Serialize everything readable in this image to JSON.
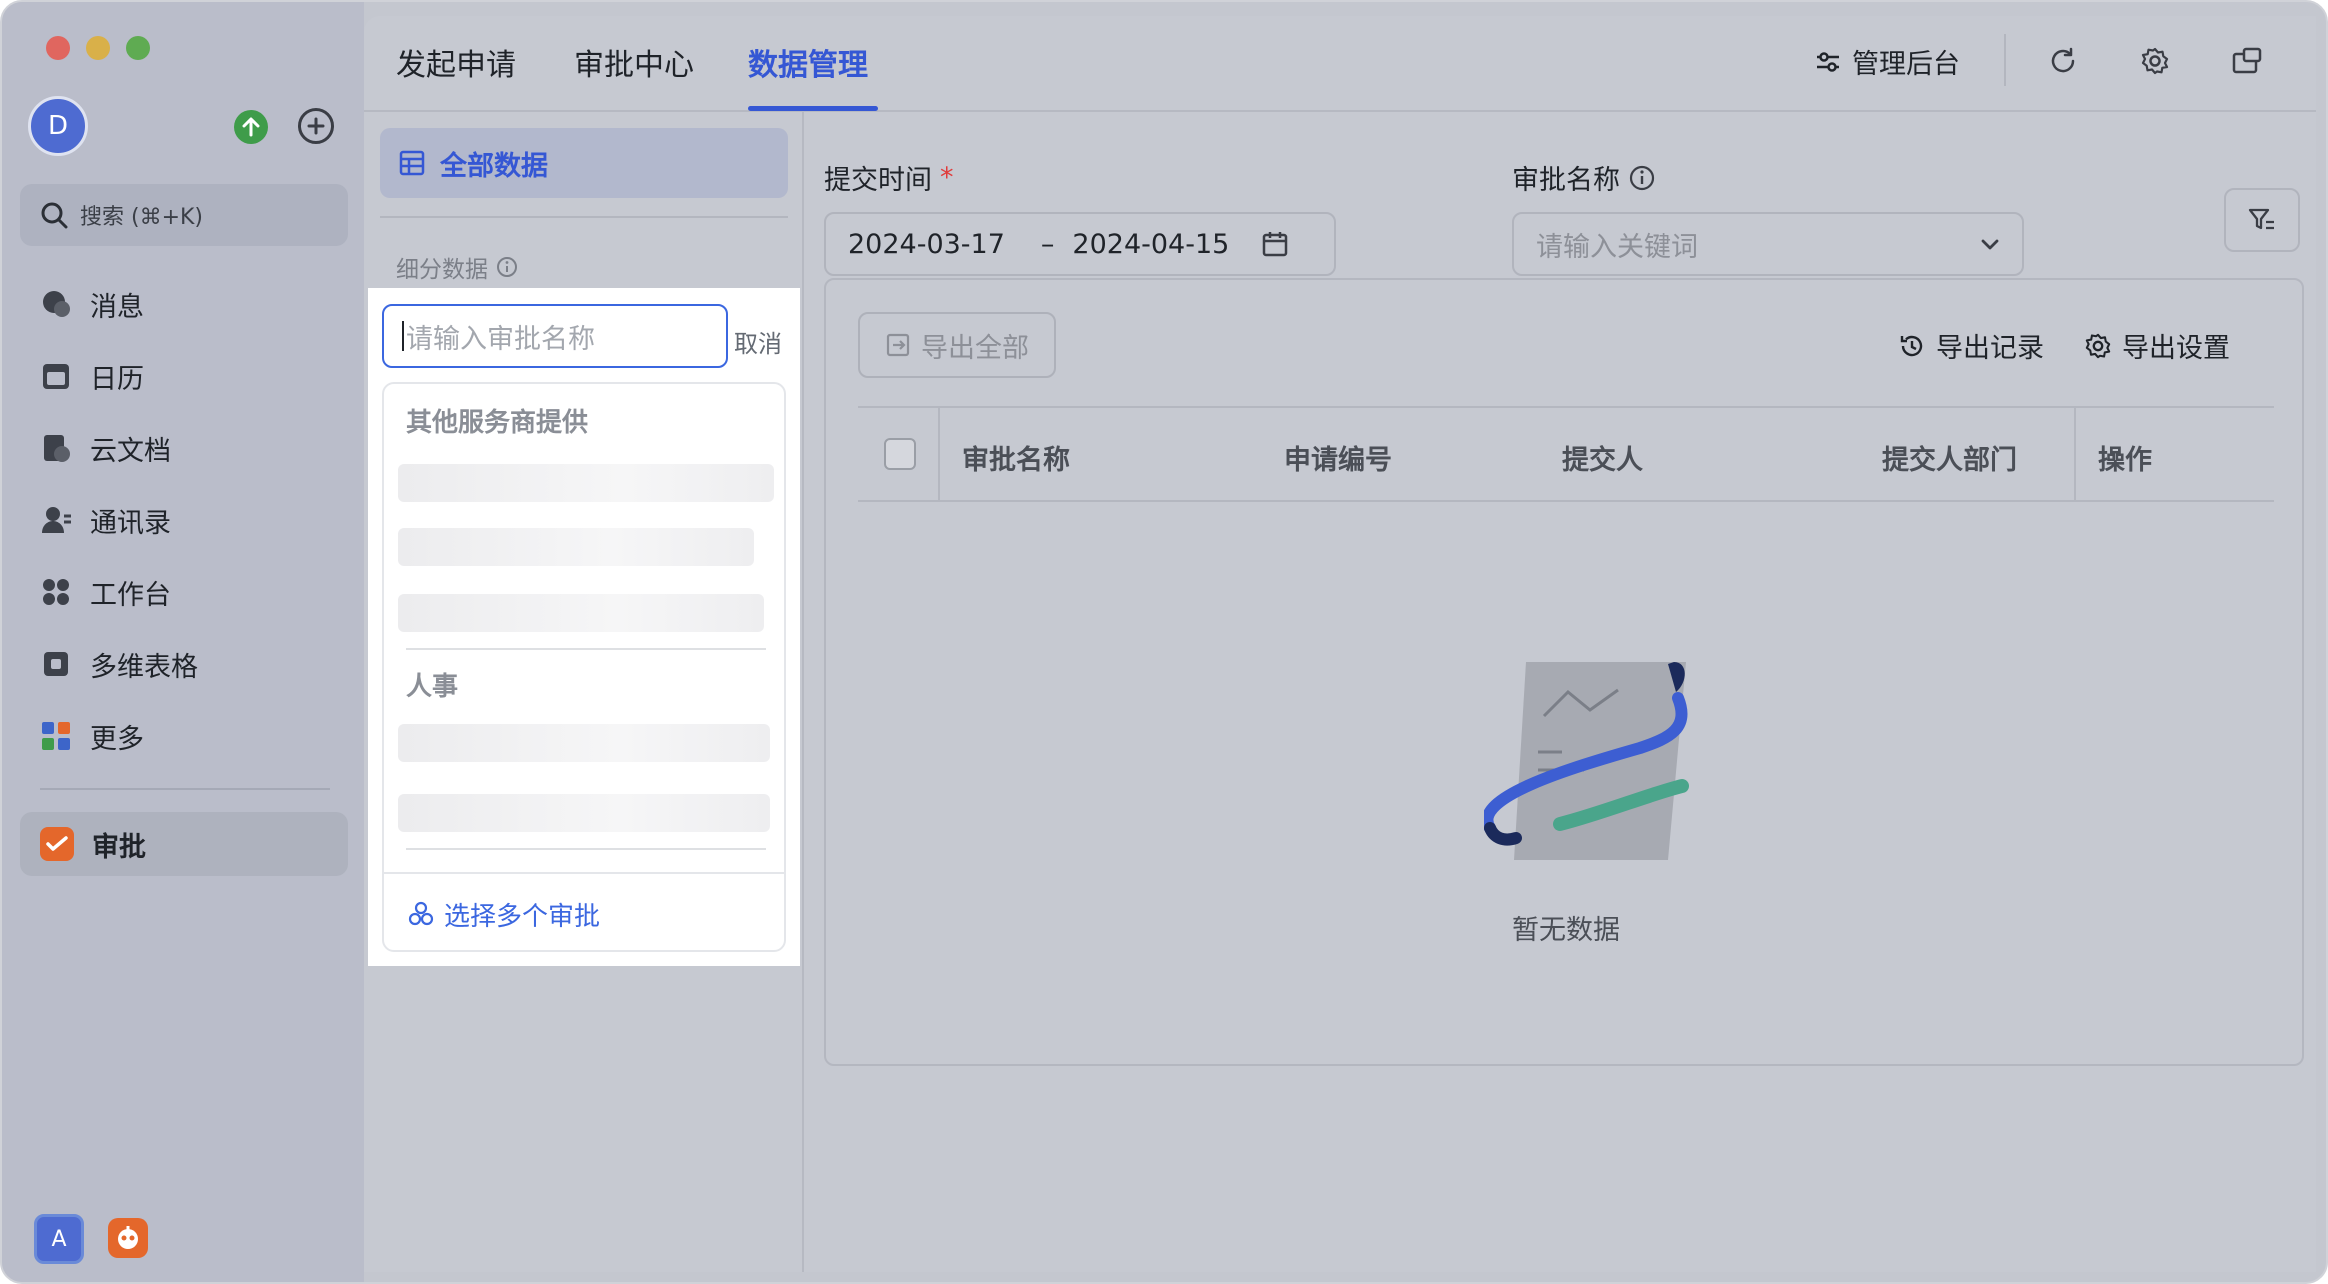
{
  "sidebar": {
    "avatar_letter": "D",
    "search_placeholder": "搜索 (⌘+K)",
    "items": [
      {
        "label": "消息",
        "icon": "chat-icon"
      },
      {
        "label": "日历",
        "icon": "calendar-icon"
      },
      {
        "label": "云文档",
        "icon": "cloud-doc-icon"
      },
      {
        "label": "通讯录",
        "icon": "contacts-icon"
      },
      {
        "label": "工作台",
        "icon": "workplace-icon"
      },
      {
        "label": "多维表格",
        "icon": "base-icon"
      },
      {
        "label": "更多",
        "icon": "more-apps-icon"
      }
    ],
    "active_item": {
      "label": "审批",
      "icon": "approval-icon"
    },
    "bottom_badge_letter": "A"
  },
  "header": {
    "tabs": [
      {
        "label": "发起申请"
      },
      {
        "label": "审批中心"
      },
      {
        "label": "数据管理"
      }
    ],
    "active_tab": "数据管理",
    "admin_label": "管理后台"
  },
  "left_panel": {
    "all_data_label": "全部数据",
    "sub_data_label": "细分数据",
    "search_placeholder": "请输入审批名称",
    "cancel_label": "取消",
    "groups": [
      {
        "title": "其他服务商提供"
      },
      {
        "title": "人事"
      }
    ],
    "select_multiple_label": "选择多个审批"
  },
  "filters": {
    "submit_time_label": "提交时间",
    "required_mark": "*",
    "date_start": "2024-03-17",
    "date_separator": "–",
    "date_end": "2024-04-15",
    "approval_name_label": "审批名称",
    "approval_name_placeholder": "请输入关键词"
  },
  "table": {
    "export_all_label": "导出全部",
    "export_records_label": "导出记录",
    "export_settings_label": "导出设置",
    "columns": [
      "审批名称",
      "申请编号",
      "提交人",
      "提交人部门",
      "操作"
    ],
    "empty_text": "暂无数据"
  },
  "colors": {
    "accent": "#3557d4",
    "approval_icon": "#e4672b"
  }
}
